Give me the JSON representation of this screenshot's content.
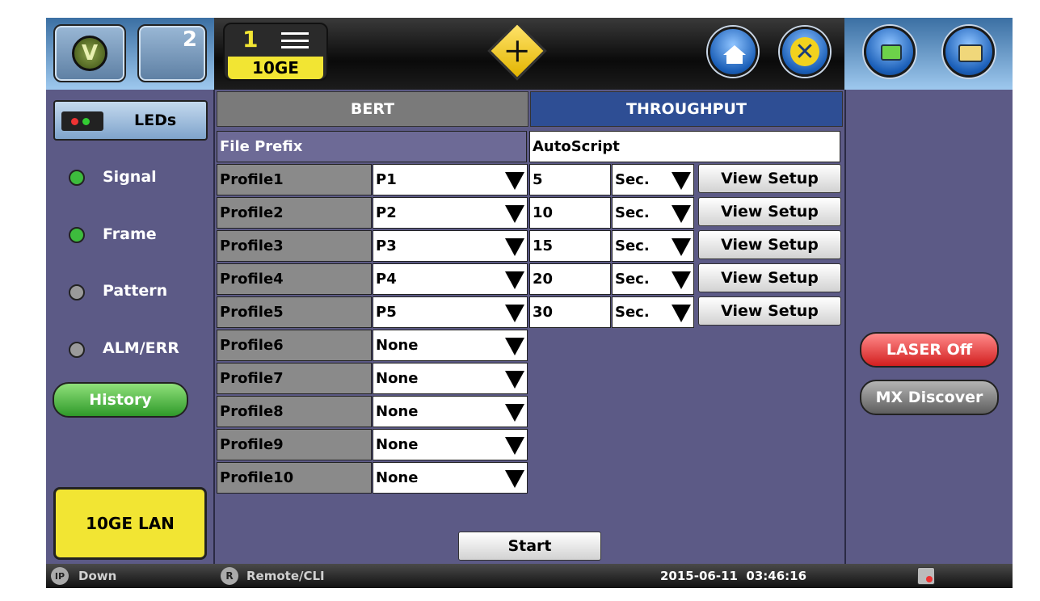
{
  "header": {
    "port_number": "1",
    "port_label": "10GE",
    "second_port_number": "2"
  },
  "left_panel": {
    "leds_label": "LEDs",
    "indicators": [
      {
        "label": "Signal",
        "color": "#3dbb3d"
      },
      {
        "label": "Frame",
        "color": "#3dbb3d"
      },
      {
        "label": "Pattern",
        "color": "#9a9a9a"
      },
      {
        "label": "ALM/ERR",
        "color": "#9a9a9a"
      }
    ],
    "history_label": "History",
    "mode_label": "10GE LAN"
  },
  "tabs": [
    {
      "label": "BERT",
      "active": false
    },
    {
      "label": "THROUGHPUT",
      "active": true
    }
  ],
  "file_prefix": {
    "label": "File Prefix",
    "value": "AutoScript"
  },
  "profiles": [
    {
      "label": "Profile1",
      "value": "P1",
      "duration": "5",
      "unit": "Sec.",
      "setup_label": "View Setup"
    },
    {
      "label": "Profile2",
      "value": "P2",
      "duration": "10",
      "unit": "Sec.",
      "setup_label": "View Setup"
    },
    {
      "label": "Profile3",
      "value": "P3",
      "duration": "15",
      "unit": "Sec.",
      "setup_label": "View Setup"
    },
    {
      "label": "Profile4",
      "value": "P4",
      "duration": "20",
      "unit": "Sec.",
      "setup_label": "View Setup"
    },
    {
      "label": "Profile5",
      "value": "P5",
      "duration": "30",
      "unit": "Sec.",
      "setup_label": "View Setup"
    },
    {
      "label": "Profile6",
      "value": "None"
    },
    {
      "label": "Profile7",
      "value": "None"
    },
    {
      "label": "Profile8",
      "value": "None"
    },
    {
      "label": "Profile9",
      "value": "None"
    },
    {
      "label": "Profile10",
      "value": "None"
    }
  ],
  "start_label": "Start",
  "right_panel": {
    "laser_label": "LASER Off",
    "discover_label": "MX Discover"
  },
  "status": {
    "ip_icon_text": "IP",
    "ip_status": "Down",
    "remote_icon_text": "R",
    "remote_status": "Remote/CLI",
    "datetime": "2015-06-11  03:46:16"
  },
  "colors": {
    "panel_bg": "#5c5a86",
    "active_tab": "#2e4e94",
    "inactive_tab": "#7a7a7a",
    "led_green": "#3dbb3d",
    "laser_red": "#e23030",
    "mode_yellow": "#f2e533"
  }
}
